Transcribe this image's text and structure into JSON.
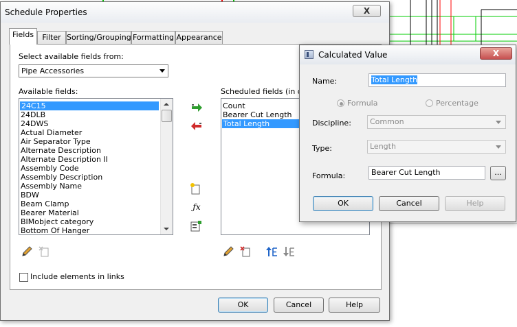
{
  "main_dialog": {
    "title": "Schedule Properties",
    "close_label": "X",
    "tabs": [
      {
        "label": "Fields"
      },
      {
        "label": "Filter"
      },
      {
        "label": "Sorting/Grouping"
      },
      {
        "label": "Formatting"
      },
      {
        "label": "Appearance"
      }
    ],
    "select_from_label": "Select available fields from:",
    "category_value": "Pipe Accessories",
    "available_label": "Available fields:",
    "available_fields": [
      "24C15",
      "24DLB",
      "24DWS",
      "Actual Diameter",
      "Air Separator Type",
      "Alternate Description",
      "Alternate Description II",
      "Assembly Code",
      "Assembly Description",
      "Assembly Name",
      "BDW",
      "Beam Clamp",
      "Bearer Material",
      "BIMobject category",
      "Bottom Of Hanger"
    ],
    "selected_available": "24C15",
    "scheduled_label": "Scheduled fields (in order):",
    "scheduled_fields": [
      "Count",
      "Bearer Cut Length",
      "Total Length"
    ],
    "selected_scheduled": "Total Length",
    "include_links_label": "Include elements in links",
    "include_links_checked": false,
    "buttons": {
      "ok": "OK",
      "cancel": "Cancel",
      "help": "Help"
    }
  },
  "calculated_dialog": {
    "title": "Calculated Value",
    "close_label": "X",
    "name_label": "Name:",
    "name_value": "Total Length",
    "formula_radio": "Formula",
    "percentage_radio": "Percentage",
    "discipline_label": "Discipline:",
    "discipline_value": "Common",
    "type_label": "Type:",
    "type_value": "Length",
    "formula_label": "Formula:",
    "formula_value": "Bearer Cut Length",
    "ellipsis": "...",
    "buttons": {
      "ok": "OK",
      "cancel": "Cancel",
      "help": "Help"
    }
  },
  "icons": {
    "add_parameter": "arrow-right-icon",
    "remove_parameter": "arrow-left-icon",
    "new_parameter": "new-parameter-icon",
    "calculated": "fx-icon",
    "combine": "combine-parameters-icon",
    "edit": "pencil-icon",
    "delete": "delete-icon",
    "move_up": "move-up-icon",
    "move_down": "move-down-icon"
  },
  "colors": {
    "selection": "#3399ff",
    "cad_green": "#00cc00",
    "cad_red": "#ff0000"
  }
}
